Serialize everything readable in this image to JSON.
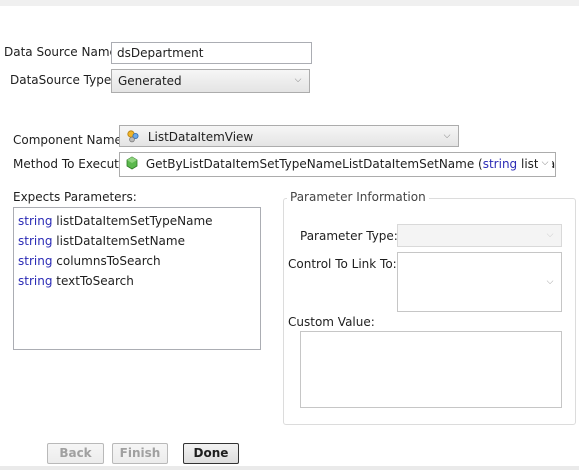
{
  "datasource": {
    "name_label": "Data Source Name:",
    "name_value": "dsDepartment",
    "type_label": "DataSource Type:",
    "type_value": "Generated"
  },
  "component": {
    "label": "Component Name:",
    "value": "ListDataItemView",
    "icon": "component-icon"
  },
  "method": {
    "label": "Method To Execute",
    "name": "GetByListDataItemSetTypeNameListDataItemSetName",
    "open_paren": " (",
    "param_type": "string",
    "param_name": " listDataItem",
    "icon": "method-icon"
  },
  "expects": {
    "label": "Expects Parameters:",
    "items": [
      {
        "type": "string",
        "name": "listDataItemSetTypeName"
      },
      {
        "type": "string",
        "name": "listDataItemSetName"
      },
      {
        "type": "string",
        "name": "columnsToSearch"
      },
      {
        "type": "string",
        "name": "textToSearch"
      }
    ]
  },
  "param_info": {
    "title": "Parameter Information",
    "type_label": "Parameter Type:",
    "control_label": "Control To Link To:",
    "custom_label": "Custom Value:"
  },
  "buttons": {
    "back": "Back",
    "finish": "Finish",
    "done": "Done"
  },
  "colors": {
    "keyword": "#2b2bb5",
    "disabled_text": "#a0a0a0"
  }
}
